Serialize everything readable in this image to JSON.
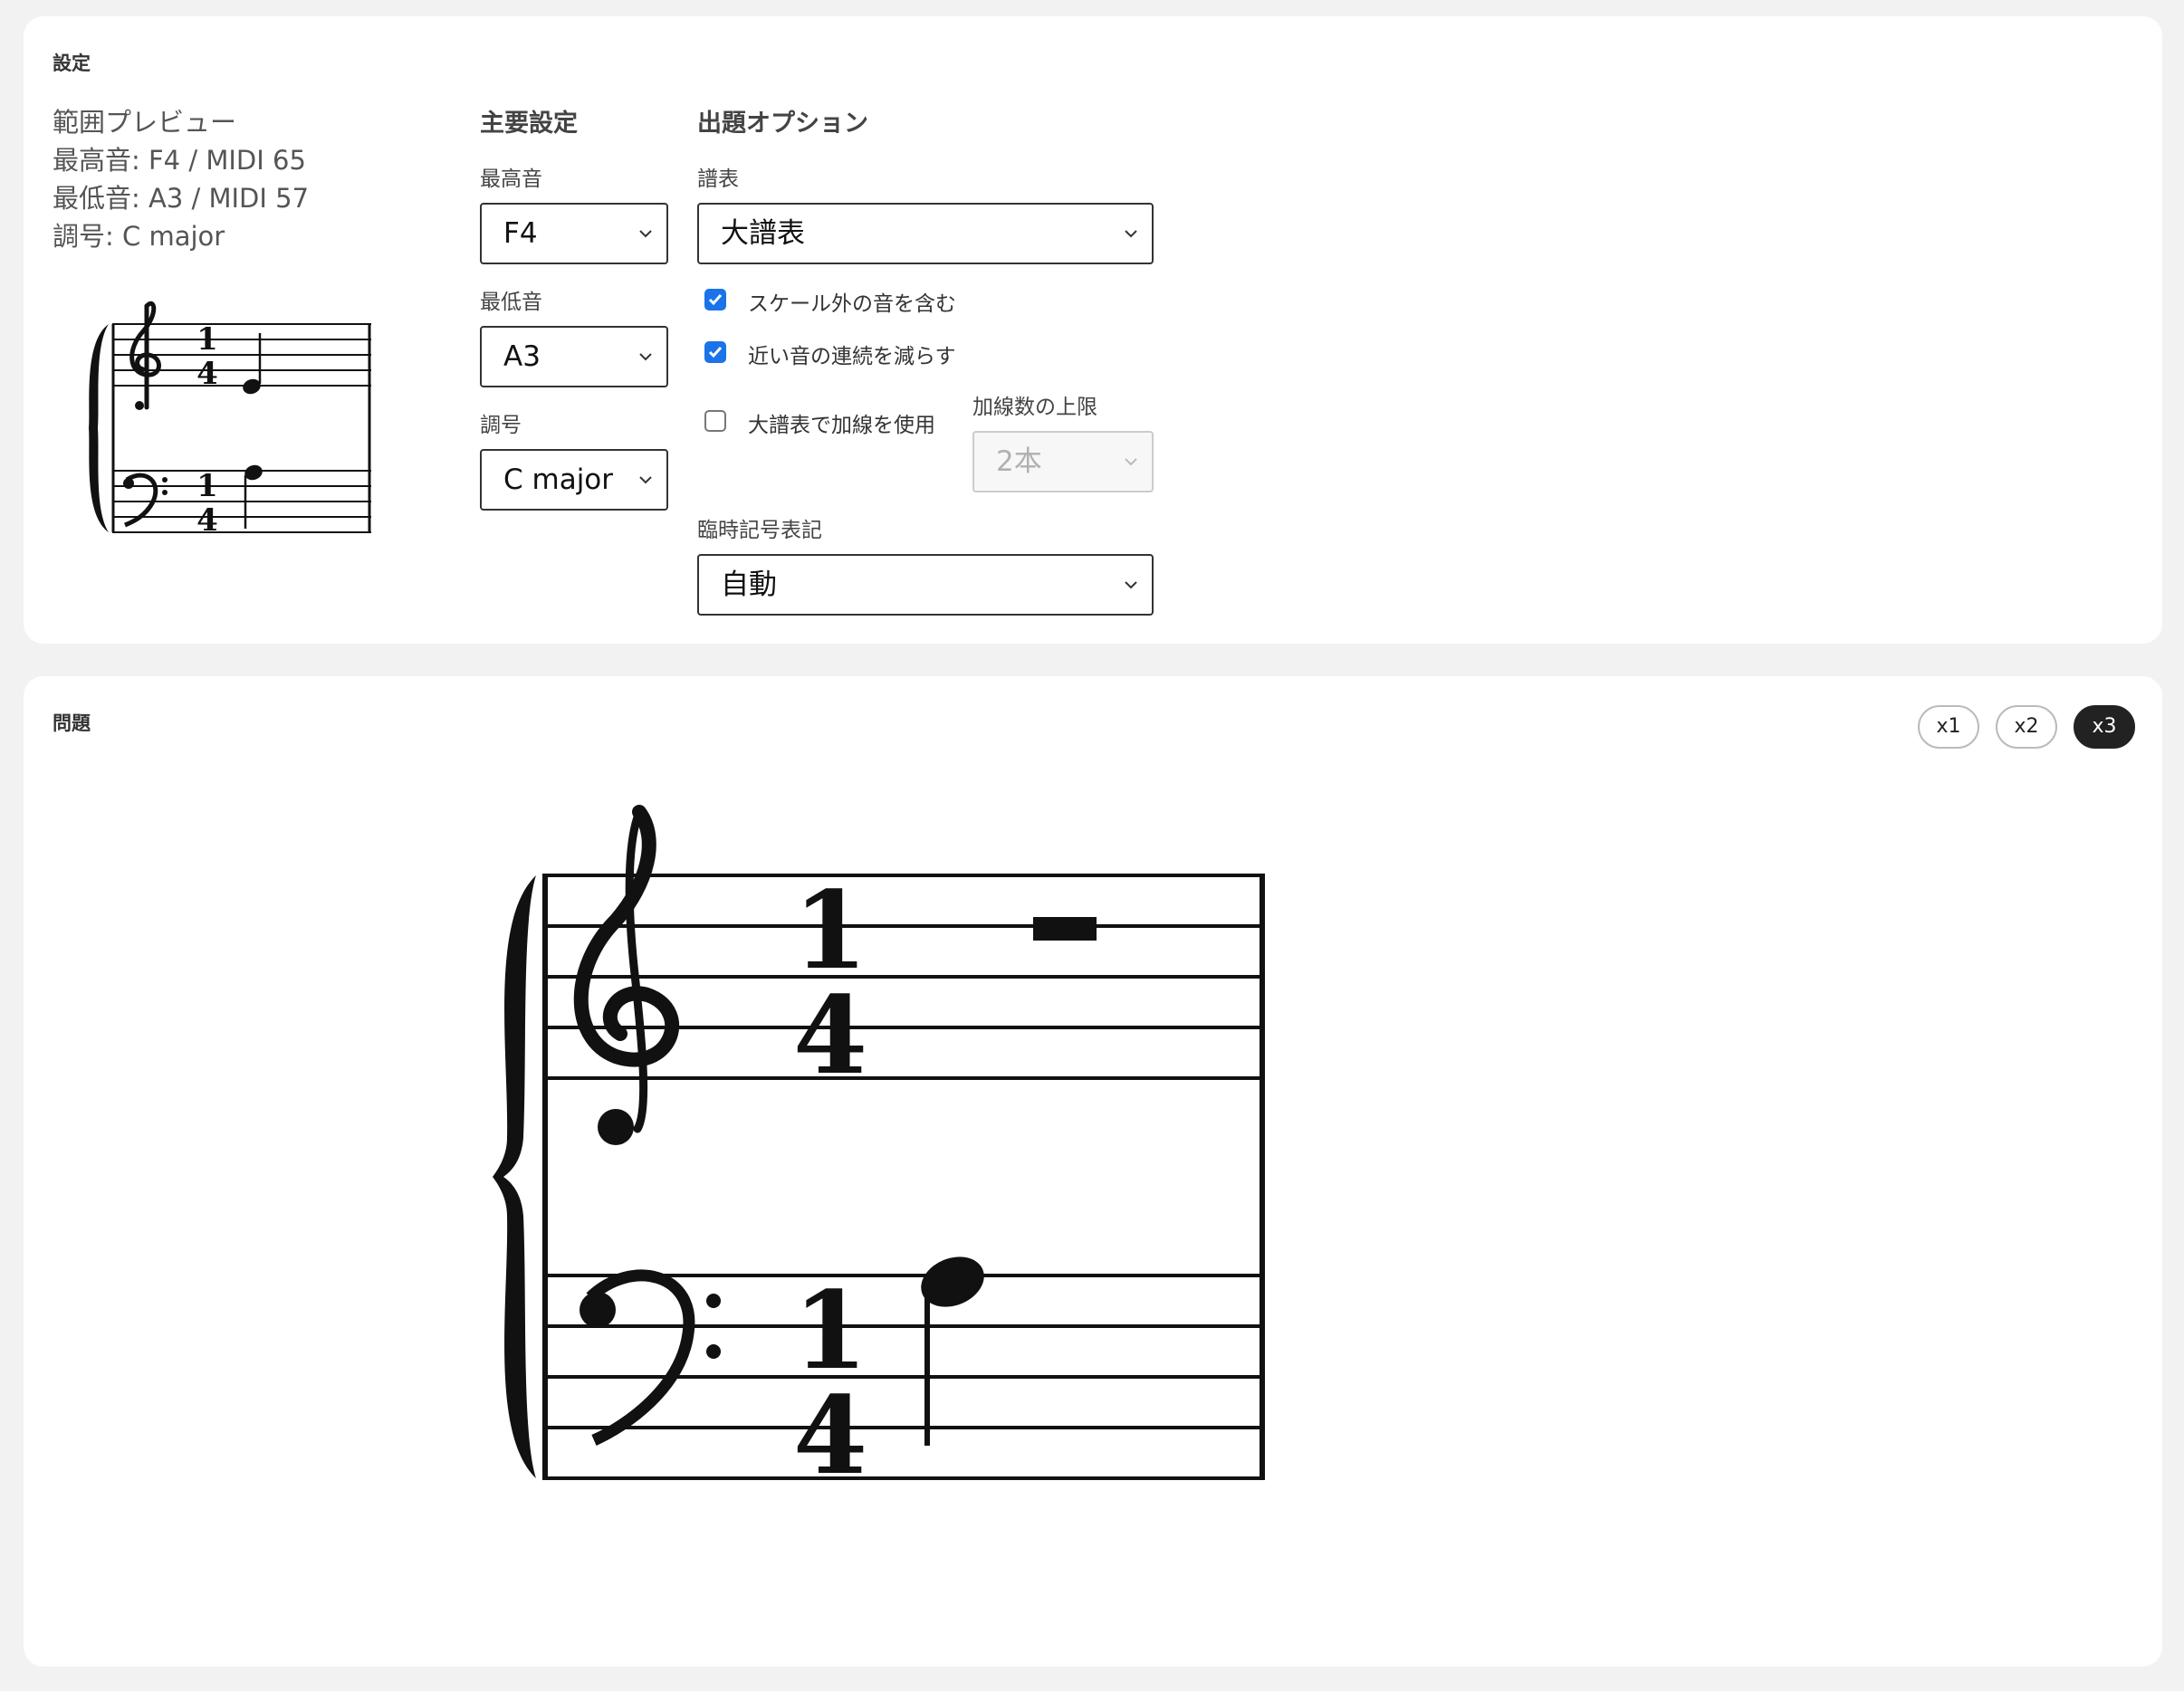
{
  "settings": {
    "title": "設定",
    "preview": {
      "heading": "範囲プレビュー",
      "highest": "最高音: F4 / MIDI 65",
      "lowest": "最低音: A3 / MIDI 57",
      "key": "調号: C major",
      "time_signature": {
        "top": "1",
        "bottom": "4"
      }
    },
    "main": {
      "heading": "主要設定",
      "highest_label": "最高音",
      "highest_value": "F4",
      "lowest_label": "最低音",
      "lowest_value": "A3",
      "key_label": "調号",
      "key_value": "C major"
    },
    "options": {
      "heading": "出題オプション",
      "staff_label": "譜表",
      "staff_value": "大譜表",
      "include_non_scale": {
        "label": "スケール外の音を含む",
        "checked": true
      },
      "reduce_close": {
        "label": "近い音の連続を減らす",
        "checked": true
      },
      "use_ledger": {
        "label": "大譜表で加線を使用",
        "checked": false
      },
      "ledger_limit_label": "加線数の上限",
      "ledger_limit_value": "2本",
      "accidental_label": "臨時記号表記",
      "accidental_value": "自動"
    }
  },
  "problem": {
    "title": "問題",
    "zoom": [
      {
        "label": "x1",
        "active": false
      },
      {
        "label": "x2",
        "active": false
      },
      {
        "label": "x3",
        "active": true
      }
    ],
    "time_signature": {
      "top": "1",
      "bottom": "4"
    }
  },
  "icons": {
    "select_chevron": "chevron-down-icon",
    "checkbox_mark": "check-icon",
    "treble_clef": "treble-clef-icon",
    "bass_clef": "bass-clef-icon",
    "brace": "brace-icon"
  },
  "colors": {
    "background": "#f2f2f2",
    "card": "#ffffff",
    "checkbox_accent": "#1a73e8",
    "active_button": "#222222"
  }
}
